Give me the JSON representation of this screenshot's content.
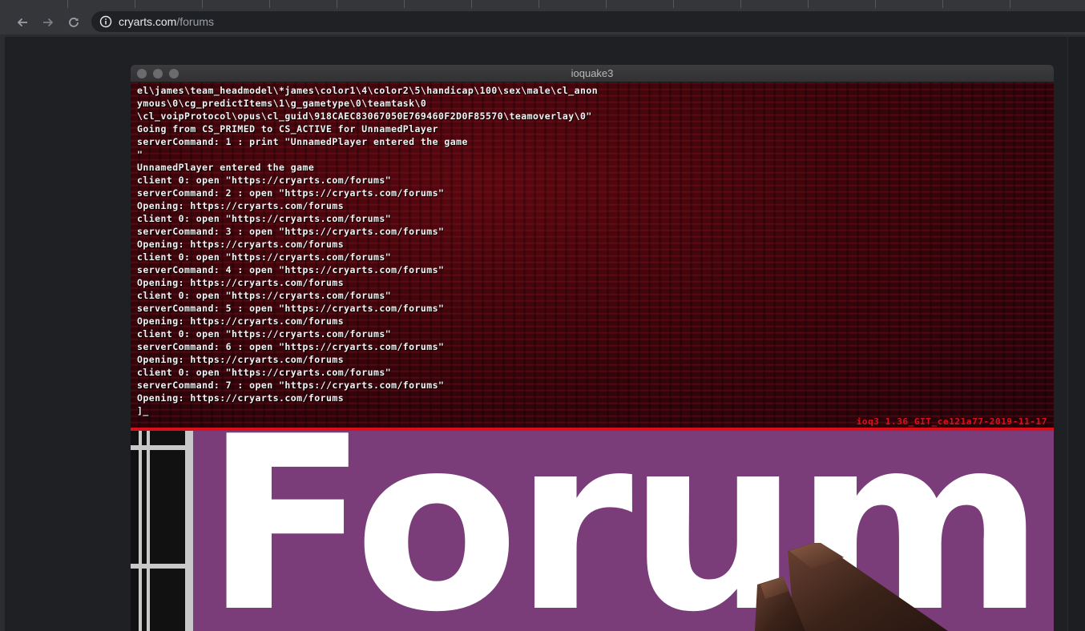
{
  "browser": {
    "url_host": "cryarts.com",
    "url_path": "/forums",
    "icons": {
      "back": "arrow-left-icon",
      "forward": "arrow-right-icon",
      "reload": "reload-icon",
      "site_info": "info-icon"
    }
  },
  "game_window": {
    "title": "ioquake3",
    "console_lines": [
      "el\\james\\team_headmodel\\*james\\color1\\4\\color2\\5\\handicap\\100\\sex\\male\\cl_anon",
      "ymous\\0\\cg_predictItems\\1\\g_gametype\\0\\teamtask\\0",
      "\\cl_voipProtocol\\opus\\cl_guid\\918CAEC83067050E769460F2D0F85570\\teamoverlay\\0\"",
      "Going from CS_PRIMED to CS_ACTIVE for UnnamedPlayer",
      "serverCommand: 1 : print \"UnnamedPlayer entered the game",
      "\"",
      "UnnamedPlayer entered the game",
      "client 0: open \"https://cryarts.com/forums\"",
      "serverCommand: 2 : open \"https://cryarts.com/forums\"",
      "Opening: https://cryarts.com/forums",
      "client 0: open \"https://cryarts.com/forums\"",
      "serverCommand: 3 : open \"https://cryarts.com/forums\"",
      "Opening: https://cryarts.com/forums",
      "client 0: open \"https://cryarts.com/forums\"",
      "serverCommand: 4 : open \"https://cryarts.com/forums\"",
      "Opening: https://cryarts.com/forums",
      "client 0: open \"https://cryarts.com/forums\"",
      "serverCommand: 5 : open \"https://cryarts.com/forums\"",
      "Opening: https://cryarts.com/forums",
      "client 0: open \"https://cryarts.com/forums\"",
      "serverCommand: 6 : open \"https://cryarts.com/forums\"",
      "Opening: https://cryarts.com/forums",
      "client 0: open \"https://cryarts.com/forums\"",
      "serverCommand: 7 : open \"https://cryarts.com/forums\"",
      "Opening: https://cryarts.com/forums",
      "]_"
    ],
    "version": "ioq3 1.36_GIT_ce121a77-2019-11-17",
    "scene_sign_text": "Forum"
  },
  "colors": {
    "console_text": "#f4f4f4",
    "version_text": "#e0101a",
    "console_border": "#d9101c",
    "sign_background": "#7a3d7a"
  }
}
